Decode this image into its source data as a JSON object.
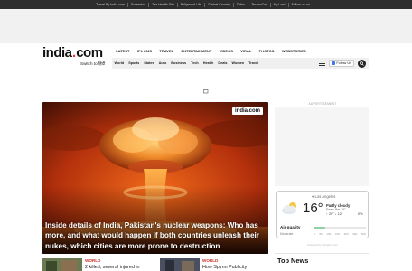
{
  "topbar": {
    "links": [
      "Travel By India.com",
      "Screentox",
      "The Health Site",
      "Bollywood Life",
      "Cricket Country",
      "Tekko",
      "TechnoCer",
      "My Lord",
      "Follow us on"
    ]
  },
  "brand": {
    "logo_word": "india",
    "logo_dot": ".",
    "logo_com": "com",
    "switch": "Switch to हिंदी"
  },
  "nav_primary": [
    "LATEST",
    "IPL 2025",
    "TRAVEL",
    "ENTERTAINMENT",
    "VIDEOS",
    "VIRAL",
    "PHOTOS",
    "WEBSTORIES"
  ],
  "nav_secondary": [
    "World",
    "Sports",
    "States",
    "Auto",
    "Business",
    "Tech",
    "Health",
    "Deals",
    "Women",
    "Travel"
  ],
  "follow_label": "Follow Us",
  "hero": {
    "badge": "india.com",
    "headline": "Inside details of India, Pakistan's nuclear weapons: Who has more, and what would happen if both countries unleash their nukes, which cities are more prone to destruction"
  },
  "advertisement_label": "ADVERTISEMENT",
  "weather": {
    "location": "Los Angeles",
    "temperature": "16°",
    "condition": "Partly cloudy",
    "feels_like": "Feels like 16°",
    "high_low": "↑ 20°  ↓ 12°",
    "precip": "0%",
    "aqi_label": "Air quality",
    "aqi_quality": "Moderate",
    "aqi_scale": [
      "0",
      "50",
      "100",
      "150",
      "200",
      "300",
      "500"
    ],
    "aqi_value_fraction": 0.22,
    "powered": "Powered by Weather.com"
  },
  "stories": [
    {
      "category": "WORLD",
      "title": "2 killed, several injured in"
    },
    {
      "category": "WORLD",
      "title": "How Spynn Publicity"
    }
  ],
  "top_news_heading": "Top News",
  "colors": {
    "accent": "#c9302c",
    "topbar": "#2d2d2d"
  }
}
